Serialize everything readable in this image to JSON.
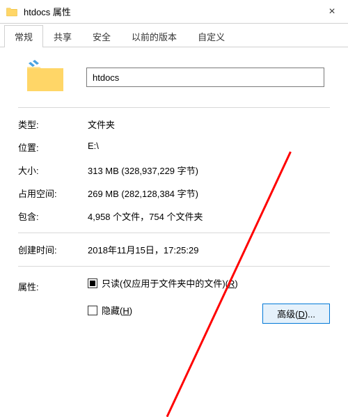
{
  "window": {
    "title": "htdocs 属性",
    "close_glyph": "×"
  },
  "tabs": {
    "general": "常规",
    "share": "共享",
    "security": "安全",
    "versions": "以前的版本",
    "custom": "自定义"
  },
  "folder_name": "htdocs",
  "labels": {
    "type": "类型:",
    "location": "位置:",
    "size": "大小:",
    "size_on_disk": "占用空间:",
    "contains": "包含:",
    "created": "创建时间:",
    "attributes": "属性:"
  },
  "values": {
    "type": "文件夹",
    "location": "E:\\",
    "size": "313 MB (328,937,229 字节)",
    "size_on_disk": "269 MB (282,128,384 字节)",
    "contains": "4,958 个文件，754 个文件夹",
    "created": "2018年11月15日，17:25:29"
  },
  "attributes": {
    "readonly_prefix": "只读(仅应用于文件夹中的文件)(",
    "readonly_key": "R",
    "readonly_suffix": ")",
    "hidden_prefix": "隐藏(",
    "hidden_key": "H",
    "hidden_suffix": ")"
  },
  "buttons": {
    "advanced_prefix": "高级(",
    "advanced_key": "D",
    "advanced_suffix": ")..."
  }
}
